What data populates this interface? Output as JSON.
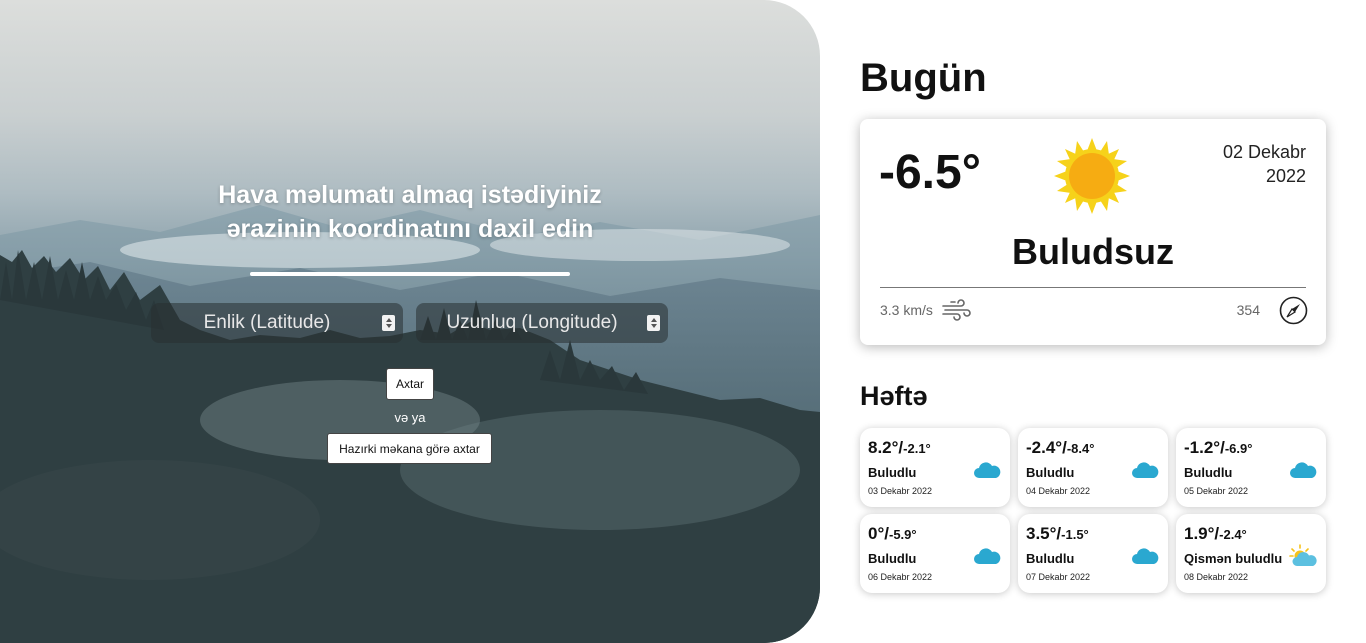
{
  "search": {
    "title_line1": "Hava məlumatı almaq istədiyiniz",
    "title_line2": "ərazinin koordinatını daxil edin",
    "latitude_placeholder": "Enlik (Latitude)",
    "longitude_placeholder": "Uzunluq (Longitude)",
    "search_button": "Axtar",
    "or_text": "və ya",
    "locate_button": "Hazırki məkana görə axtar"
  },
  "today": {
    "heading": "Bugün",
    "temperature": "-6.5°",
    "date_line1": "02 Dekabr",
    "date_line2": "2022",
    "condition": "Buludsuz",
    "condition_icon": "sun-icon",
    "wind_speed": "3.3 km/s",
    "wind_direction": "354"
  },
  "week": {
    "heading": "Həftə",
    "days": [
      {
        "high": "8.2°/",
        "low": "-2.1°",
        "condition": "Buludlu",
        "date": "03 Dekabr 2022",
        "icon": "cloud-icon"
      },
      {
        "high": "-2.4°/",
        "low": "-8.4°",
        "condition": "Buludlu",
        "date": "04 Dekabr 2022",
        "icon": "cloud-icon"
      },
      {
        "high": "-1.2°/",
        "low": "-6.9°",
        "condition": "Buludlu",
        "date": "05 Dekabr 2022",
        "icon": "cloud-icon"
      },
      {
        "high": "0°/",
        "low": "-5.9°",
        "condition": "Buludlu",
        "date": "06 Dekabr 2022",
        "icon": "cloud-icon"
      },
      {
        "high": "3.5°/",
        "low": "-1.5°",
        "condition": "Buludlu",
        "date": "07 Dekabr 2022",
        "icon": "cloud-icon"
      },
      {
        "high": "1.9°/",
        "low": "-2.4°",
        "condition": "Qismən buludlu",
        "date": "08 Dekabr 2022",
        "icon": "partly-cloudy-icon"
      }
    ]
  },
  "colors": {
    "sun": "#f6b51a",
    "cloud": "#2aa8d0",
    "card_bg": "#ffffff"
  }
}
